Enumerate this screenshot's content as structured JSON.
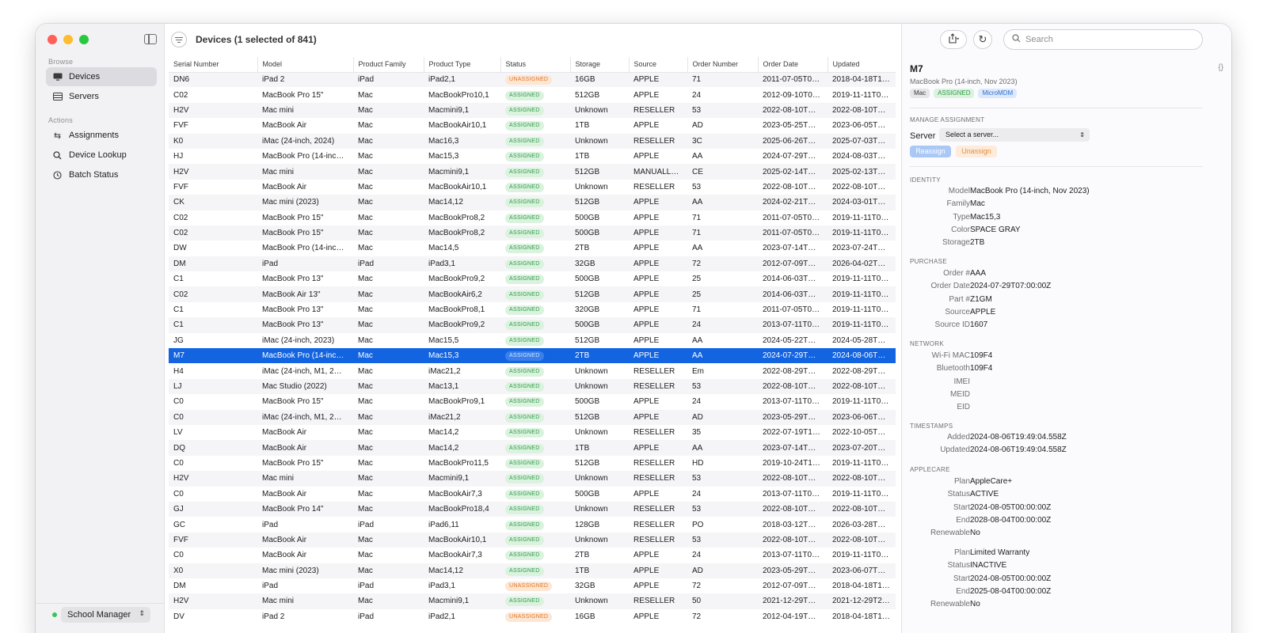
{
  "sidebar": {
    "browse_label": "Browse",
    "actions_label": "Actions",
    "items": [
      {
        "label": "Devices"
      },
      {
        "label": "Servers"
      },
      {
        "label": "Assignments"
      },
      {
        "label": "Device Lookup"
      },
      {
        "label": "Batch Status"
      }
    ],
    "footer_server": "School Manager"
  },
  "main": {
    "title": "Devices (1 selected of 841)",
    "columns": [
      "Serial Number",
      "Model",
      "Product Family",
      "Product Type",
      "Status",
      "Storage",
      "Source",
      "Order Number",
      "Order Date",
      "Updated"
    ],
    "rows": [
      {
        "serial": "DN6",
        "model": "iPad 2",
        "family": "iPad",
        "type": "iPad2,1",
        "status": "UNASSIGNED",
        "storage": "16GB",
        "source": "APPLE",
        "order": "71",
        "order_date": "2011-07-05T0…",
        "updated": "2018-04-18T1…"
      },
      {
        "serial": "C02",
        "model": "MacBook Pro 15\"",
        "family": "Mac",
        "type": "MacBookPro10,1",
        "status": "ASSIGNED",
        "storage": "512GB",
        "source": "APPLE",
        "order": "24",
        "order_date": "2012-09-10T0…",
        "updated": "2019-11-11T0…"
      },
      {
        "serial": "H2V",
        "model": "Mac mini",
        "family": "Mac",
        "type": "Macmini9,1",
        "status": "ASSIGNED",
        "storage": "Unknown",
        "source": "RESELLER",
        "order": "53",
        "order_date": "2022-08-10T…",
        "updated": "2022-08-10T…"
      },
      {
        "serial": "FVF",
        "model": "MacBook Air",
        "family": "Mac",
        "type": "MacBookAir10,1",
        "status": "ASSIGNED",
        "storage": "1TB",
        "source": "APPLE",
        "order": "AD",
        "order_date": "2023-05-25T…",
        "updated": "2023-06-05T…"
      },
      {
        "serial": "K0",
        "model": "iMac (24-inch, 2024)",
        "family": "Mac",
        "type": "Mac16,3",
        "status": "ASSIGNED",
        "storage": "Unknown",
        "source": "RESELLER",
        "order": "3C",
        "order_date": "2025-06-26T…",
        "updated": "2025-07-03T…"
      },
      {
        "serial": "HJ",
        "model": "MacBook Pro (14-inc…",
        "family": "Mac",
        "type": "Mac15,3",
        "status": "ASSIGNED",
        "storage": "1TB",
        "source": "APPLE",
        "order": "AA",
        "order_date": "2024-07-29T…",
        "updated": "2024-08-03T…"
      },
      {
        "serial": "H2V",
        "model": "Mac mini",
        "family": "Mac",
        "type": "Macmini9,1",
        "status": "ASSIGNED",
        "storage": "512GB",
        "source": "MANUALL…",
        "order": "CE",
        "order_date": "2025-02-14T…",
        "updated": "2025-02-13T…"
      },
      {
        "serial": "FVF",
        "model": "MacBook Air",
        "family": "Mac",
        "type": "MacBookAir10,1",
        "status": "ASSIGNED",
        "storage": "Unknown",
        "source": "RESELLER",
        "order": "53",
        "order_date": "2022-08-10T…",
        "updated": "2022-08-10T…"
      },
      {
        "serial": "CK",
        "model": "Mac mini (2023)",
        "family": "Mac",
        "type": "Mac14,12",
        "status": "ASSIGNED",
        "storage": "512GB",
        "source": "APPLE",
        "order": "AA",
        "order_date": "2024-02-21T…",
        "updated": "2024-03-01T…"
      },
      {
        "serial": "C02",
        "model": "MacBook Pro 15\"",
        "family": "Mac",
        "type": "MacBookPro8,2",
        "status": "ASSIGNED",
        "storage": "500GB",
        "source": "APPLE",
        "order": "71",
        "order_date": "2011-07-05T0…",
        "updated": "2019-11-11T0…"
      },
      {
        "serial": "C02",
        "model": "MacBook Pro 15\"",
        "family": "Mac",
        "type": "MacBookPro8,2",
        "status": "ASSIGNED",
        "storage": "500GB",
        "source": "APPLE",
        "order": "71",
        "order_date": "2011-07-05T0…",
        "updated": "2019-11-11T0…"
      },
      {
        "serial": "DW",
        "model": "MacBook Pro (14-inc…",
        "family": "Mac",
        "type": "Mac14,5",
        "status": "ASSIGNED",
        "storage": "2TB",
        "source": "APPLE",
        "order": "AA",
        "order_date": "2023-07-14T…",
        "updated": "2023-07-24T…"
      },
      {
        "serial": "DM",
        "model": "iPad",
        "family": "iPad",
        "type": "iPad3,1",
        "status": "ASSIGNED",
        "storage": "32GB",
        "source": "APPLE",
        "order": "72",
        "order_date": "2012-07-09T…",
        "updated": "2026-04-02T…"
      },
      {
        "serial": "C1",
        "model": "MacBook Pro 13\"",
        "family": "Mac",
        "type": "MacBookPro9,2",
        "status": "ASSIGNED",
        "storage": "500GB",
        "source": "APPLE",
        "order": "25",
        "order_date": "2014-06-03T…",
        "updated": "2019-11-11T0…"
      },
      {
        "serial": "C02",
        "model": "MacBook Air 13\"",
        "family": "Mac",
        "type": "MacBookAir6,2",
        "status": "ASSIGNED",
        "storage": "512GB",
        "source": "APPLE",
        "order": "25",
        "order_date": "2014-06-03T…",
        "updated": "2019-11-11T0…"
      },
      {
        "serial": "C1",
        "model": "MacBook Pro 13\"",
        "family": "Mac",
        "type": "MacBookPro8,1",
        "status": "ASSIGNED",
        "storage": "320GB",
        "source": "APPLE",
        "order": "71",
        "order_date": "2011-07-05T0…",
        "updated": "2019-11-11T0…"
      },
      {
        "serial": "C1",
        "model": "MacBook Pro 13\"",
        "family": "Mac",
        "type": "MacBookPro9,2",
        "status": "ASSIGNED",
        "storage": "500GB",
        "source": "APPLE",
        "order": "24",
        "order_date": "2013-07-11T0…",
        "updated": "2019-11-11T0…"
      },
      {
        "serial": "JG",
        "model": "iMac (24-inch, 2023)",
        "family": "Mac",
        "type": "Mac15,5",
        "status": "ASSIGNED",
        "storage": "512GB",
        "source": "APPLE",
        "order": "AA",
        "order_date": "2024-05-22T…",
        "updated": "2024-05-28T…"
      },
      {
        "serial": "M7",
        "model": "MacBook Pro (14-inc…",
        "family": "Mac",
        "type": "Mac15,3",
        "status": "ASSIGNED",
        "storage": "2TB",
        "source": "APPLE",
        "order": "AA",
        "order_date": "2024-07-29T…",
        "updated": "2024-08-06T…",
        "selected": true
      },
      {
        "serial": "H4",
        "model": "iMac (24-inch, M1, 2…",
        "family": "Mac",
        "type": "iMac21,2",
        "status": "ASSIGNED",
        "storage": "Unknown",
        "source": "RESELLER",
        "order": "Em",
        "order_date": "2022-08-29T…",
        "updated": "2022-08-29T…"
      },
      {
        "serial": "LJ",
        "model": "Mac Studio (2022)",
        "family": "Mac",
        "type": "Mac13,1",
        "status": "ASSIGNED",
        "storage": "Unknown",
        "source": "RESELLER",
        "order": "53",
        "order_date": "2022-08-10T…",
        "updated": "2022-08-10T…"
      },
      {
        "serial": "C0",
        "model": "MacBook Pro 15\"",
        "family": "Mac",
        "type": "MacBookPro9,1",
        "status": "ASSIGNED",
        "storage": "500GB",
        "source": "APPLE",
        "order": "24",
        "order_date": "2013-07-11T0…",
        "updated": "2019-11-11T0…"
      },
      {
        "serial": "C0",
        "model": "iMac (24-inch, M1, 2…",
        "family": "Mac",
        "type": "iMac21,2",
        "status": "ASSIGNED",
        "storage": "512GB",
        "source": "APPLE",
        "order": "AD",
        "order_date": "2023-05-29T…",
        "updated": "2023-06-06T…"
      },
      {
        "serial": "LV",
        "model": "MacBook Air",
        "family": "Mac",
        "type": "Mac14,2",
        "status": "ASSIGNED",
        "storage": "Unknown",
        "source": "RESELLER",
        "order": "35",
        "order_date": "2022-07-19T1…",
        "updated": "2022-10-05T…"
      },
      {
        "serial": "DQ",
        "model": "MacBook Air",
        "family": "Mac",
        "type": "Mac14,2",
        "status": "ASSIGNED",
        "storage": "1TB",
        "source": "APPLE",
        "order": "AA",
        "order_date": "2023-07-14T…",
        "updated": "2023-07-20T…"
      },
      {
        "serial": "C0",
        "model": "MacBook Pro 15\"",
        "family": "Mac",
        "type": "MacBookPro11,5",
        "status": "ASSIGNED",
        "storage": "512GB",
        "source": "RESELLER",
        "order": "HD",
        "order_date": "2019-10-24T1…",
        "updated": "2019-11-11T0…"
      },
      {
        "serial": "H2V",
        "model": "Mac mini",
        "family": "Mac",
        "type": "Macmini9,1",
        "status": "ASSIGNED",
        "storage": "Unknown",
        "source": "RESELLER",
        "order": "53",
        "order_date": "2022-08-10T…",
        "updated": "2022-08-10T…"
      },
      {
        "serial": "C0",
        "model": "MacBook Air",
        "family": "Mac",
        "type": "MacBookAir7,3",
        "status": "ASSIGNED",
        "storage": "500GB",
        "source": "APPLE",
        "order": "24",
        "order_date": "2013-07-11T0…",
        "updated": "2019-11-11T0…"
      },
      {
        "serial": "GJ",
        "model": "MacBook Pro 14\"",
        "family": "Mac",
        "type": "MacBookPro18,4",
        "status": "ASSIGNED",
        "storage": "Unknown",
        "source": "RESELLER",
        "order": "53",
        "order_date": "2022-08-10T…",
        "updated": "2022-08-10T…"
      },
      {
        "serial": "GC",
        "model": "iPad",
        "family": "iPad",
        "type": "iPad6,11",
        "status": "ASSIGNED",
        "storage": "128GB",
        "source": "RESELLER",
        "order": "PO",
        "order_date": "2018-03-12T…",
        "updated": "2026-03-28T…"
      },
      {
        "serial": "FVF",
        "model": "MacBook Air",
        "family": "Mac",
        "type": "MacBookAir10,1",
        "status": "ASSIGNED",
        "storage": "Unknown",
        "source": "RESELLER",
        "order": "53",
        "order_date": "2022-08-10T…",
        "updated": "2022-08-10T…"
      },
      {
        "serial": "C0",
        "model": "MacBook Air",
        "family": "Mac",
        "type": "MacBookAir7,3",
        "status": "ASSIGNED",
        "storage": "2TB",
        "source": "APPLE",
        "order": "24",
        "order_date": "2013-07-11T0…",
        "updated": "2019-11-11T0…"
      },
      {
        "serial": "X0",
        "model": "Mac mini (2023)",
        "family": "Mac",
        "type": "Mac14,12",
        "status": "ASSIGNED",
        "storage": "1TB",
        "source": "APPLE",
        "order": "AD",
        "order_date": "2023-05-29T…",
        "updated": "2023-06-07T…"
      },
      {
        "serial": "DM",
        "model": "iPad",
        "family": "iPad",
        "type": "iPad3,1",
        "status": "UNASSIGNED",
        "storage": "32GB",
        "source": "APPLE",
        "order": "72",
        "order_date": "2012-07-09T…",
        "updated": "2018-04-18T1…"
      },
      {
        "serial": "H2V",
        "model": "Mac mini",
        "family": "Mac",
        "type": "Macmini9,1",
        "status": "ASSIGNED",
        "storage": "Unknown",
        "source": "RESELLER",
        "order": "50",
        "order_date": "2021-12-29T…",
        "updated": "2021-12-29T2…"
      },
      {
        "serial": "DV",
        "model": "iPad 2",
        "family": "iPad",
        "type": "iPad2,1",
        "status": "UNASSIGNED",
        "storage": "16GB",
        "source": "APPLE",
        "order": "72",
        "order_date": "2012-04-19T…",
        "updated": "2018-04-18T1…"
      }
    ]
  },
  "detail": {
    "search_placeholder": "Search",
    "title": "M7",
    "json_glyph": "{}",
    "subtitle": "MacBook Pro (14-inch, Nov 2023)",
    "tags": [
      "Mac",
      "ASSIGNED",
      "MicroMDM"
    ],
    "manage_heading": "MANAGE ASSIGNMENT",
    "server_label": "Server",
    "server_select": "Select a server...",
    "reassign_label": "Reassign",
    "unassign_label": "Unassign",
    "identity_heading": "IDENTITY",
    "identity": [
      {
        "k": "Model",
        "v": "MacBook Pro (14-inch, Nov 2023)"
      },
      {
        "k": "Family",
        "v": "Mac"
      },
      {
        "k": "Type",
        "v": "Mac15,3"
      },
      {
        "k": "Color",
        "v": "SPACE GRAY"
      },
      {
        "k": "Storage",
        "v": "2TB"
      }
    ],
    "purchase_heading": "PURCHASE",
    "purchase": [
      {
        "k": "Order #",
        "v": "AAA"
      },
      {
        "k": "Order Date",
        "v": "2024-07-29T07:00:00Z"
      },
      {
        "k": "Part #",
        "v": "Z1GM"
      },
      {
        "k": "Source",
        "v": "APPLE"
      },
      {
        "k": "Source ID",
        "v": "1607"
      }
    ],
    "network_heading": "NETWORK",
    "network": [
      {
        "k": "Wi-Fi MAC",
        "v": "109F4"
      },
      {
        "k": "Bluetooth",
        "v": "109F4"
      },
      {
        "k": "IMEI",
        "v": ""
      },
      {
        "k": "MEID",
        "v": ""
      },
      {
        "k": "EID",
        "v": ""
      }
    ],
    "timestamps_heading": "TIMESTAMPS",
    "timestamps": [
      {
        "k": "Added",
        "v": "2024-08-06T19:49:04.558Z"
      },
      {
        "k": "Updated",
        "v": "2024-08-06T19:49:04.558Z"
      }
    ],
    "applecare_heading": "APPLECARE",
    "applecare": [
      {
        "k": "Plan",
        "v": "AppleCare+"
      },
      {
        "k": "Status",
        "v": "ACTIVE"
      },
      {
        "k": "Start",
        "v": "2024-08-05T00:00:00Z"
      },
      {
        "k": "End",
        "v": "2028-08-04T00:00:00Z"
      },
      {
        "k": "Renewable",
        "v": "No"
      }
    ],
    "applecare2": [
      {
        "k": "Plan",
        "v": "Limited Warranty"
      },
      {
        "k": "Status",
        "v": "INACTIVE"
      },
      {
        "k": "Start",
        "v": "2024-08-05T00:00:00Z"
      },
      {
        "k": "End",
        "v": "2025-08-04T00:00:00Z"
      },
      {
        "k": "Renewable",
        "v": "No"
      }
    ]
  },
  "colors": {
    "selection": "#1364e0",
    "assigned_text": "#2e9b46",
    "unassigned_text": "#e07824",
    "close": "#ff5f57",
    "minimize": "#febc2e",
    "zoom": "#28c840"
  }
}
